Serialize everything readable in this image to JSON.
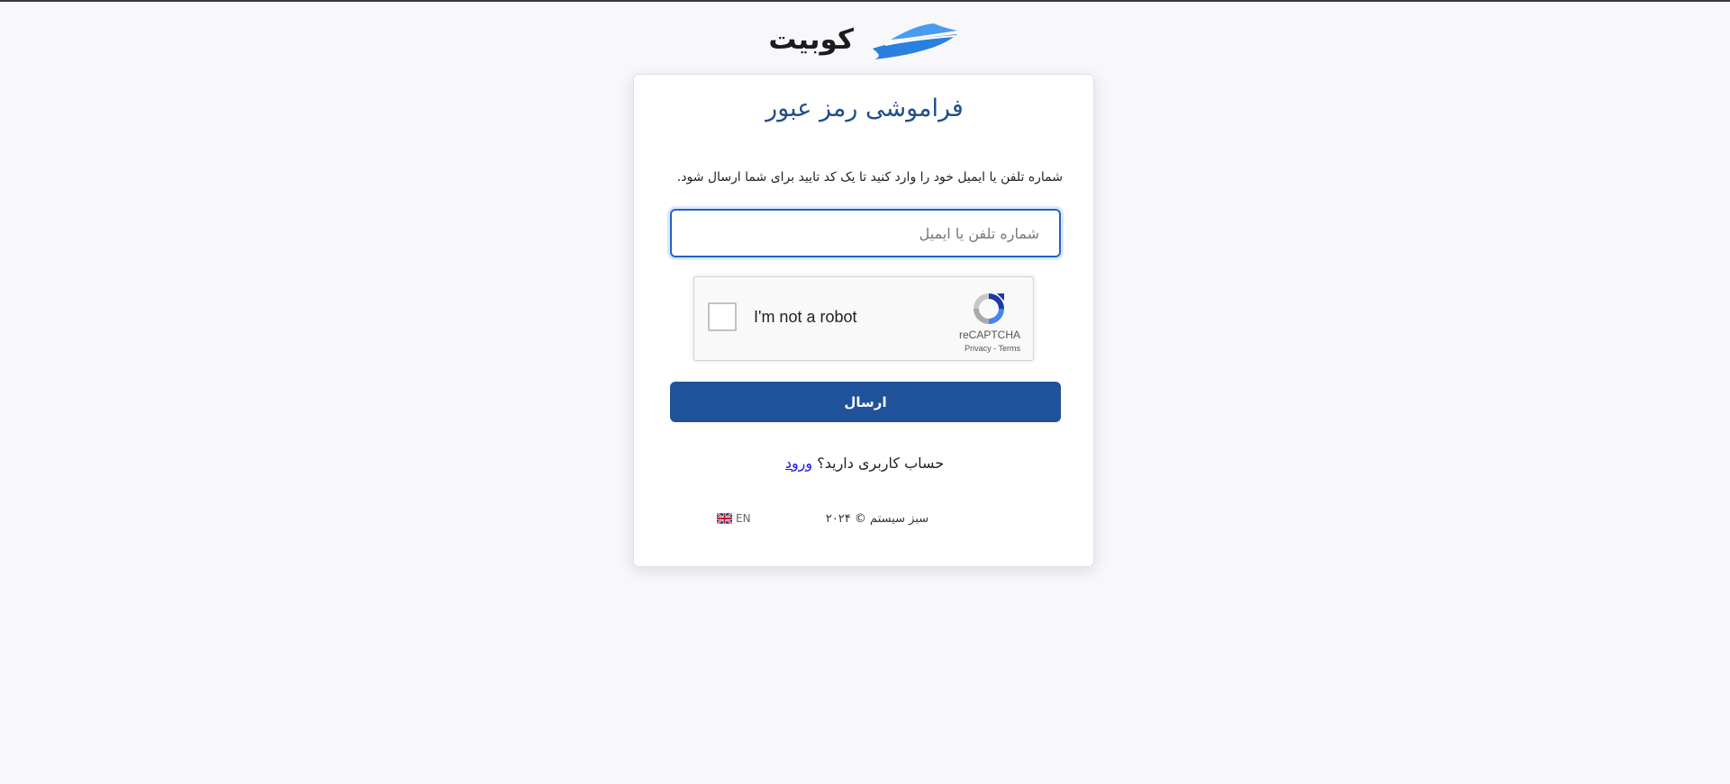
{
  "brand": {
    "name": "کوبیت",
    "logo_icon": "boat-wave-logo",
    "accent_color": "#2a80e0"
  },
  "form": {
    "title": "فراموشی رمز عبور",
    "description": "شماره تلفن یا ایمیل خود را وارد کنید تا یک کد تایید برای شما ارسال شود.",
    "input_value": "",
    "input_placeholder": "شماره تلفن یا ایمیل",
    "submit_label": "ارسال",
    "submit_color": "#1f529a"
  },
  "recaptcha": {
    "checkbox_label": "I'm not a robot",
    "brand": "reCAPTCHA",
    "privacy": "Privacy",
    "separator": " - ",
    "terms": "Terms",
    "checked": false
  },
  "login": {
    "prompt": "حساب کاربری دارید؟",
    "link": "ورود"
  },
  "footer": {
    "copyright": "سبز سیستم © ۲۰۲۴",
    "language_label": "EN",
    "language_icon": "uk-flag-icon"
  }
}
